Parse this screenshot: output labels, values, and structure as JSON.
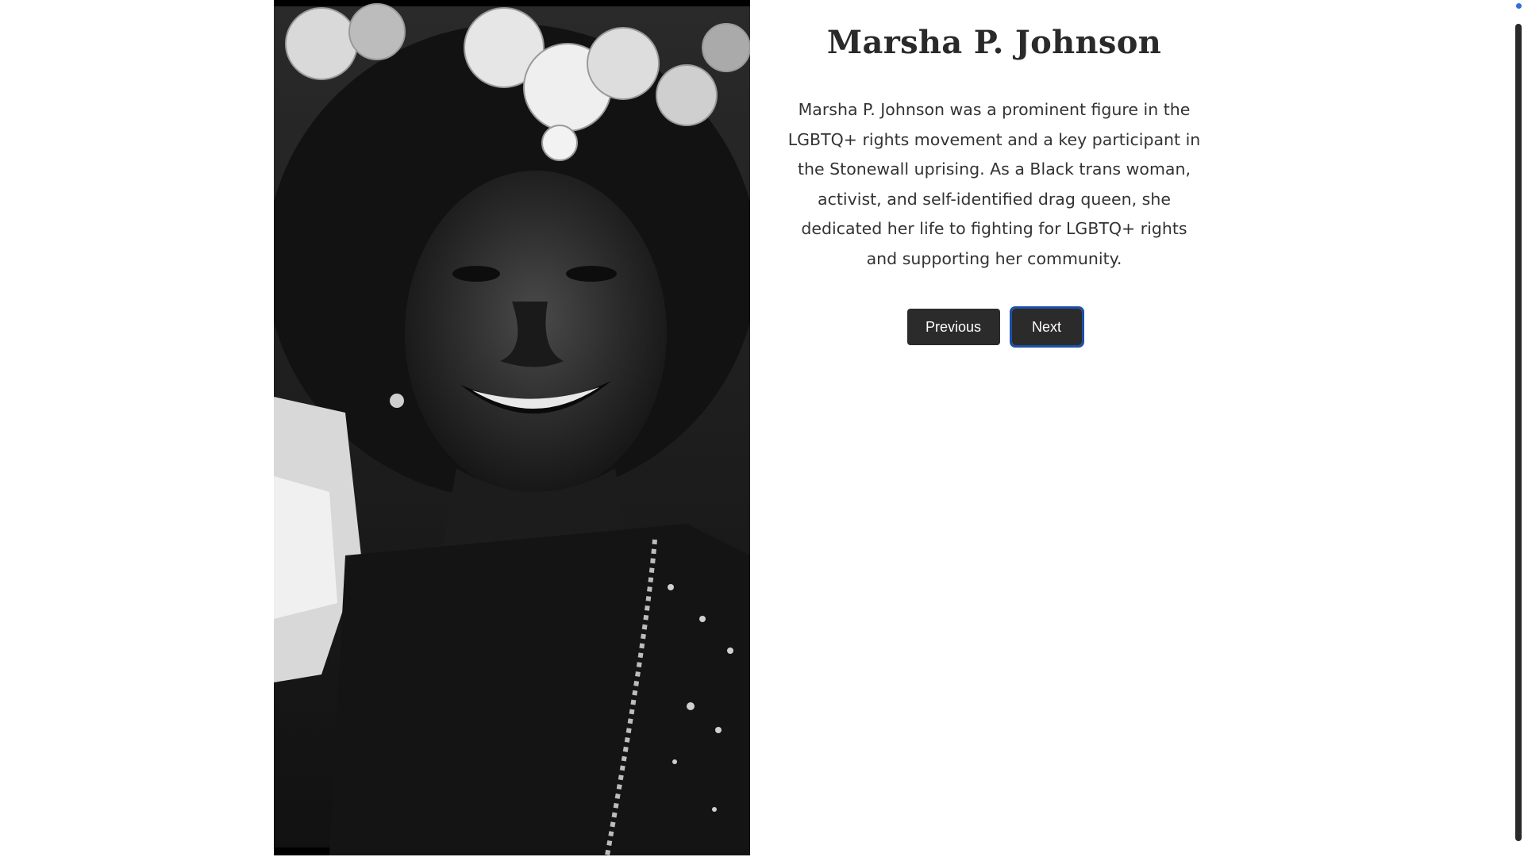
{
  "profile": {
    "name": "Marsha P. Johnson",
    "bio": "Marsha P. Johnson was a prominent figure in the LGBTQ+ rights movement and a key participant in the Stonewall uprising. As a Black trans woman, activist, and self-identified drag queen, she dedicated her life to fighting for LGBTQ+ rights and supporting her community.",
    "photo_description": "portrait-photo"
  },
  "navigation": {
    "previous_label": "Previous",
    "next_label": "Next"
  },
  "colors": {
    "button_bg": "#2b2b2b",
    "focus_ring": "#1e4fa8",
    "text": "#333333"
  }
}
